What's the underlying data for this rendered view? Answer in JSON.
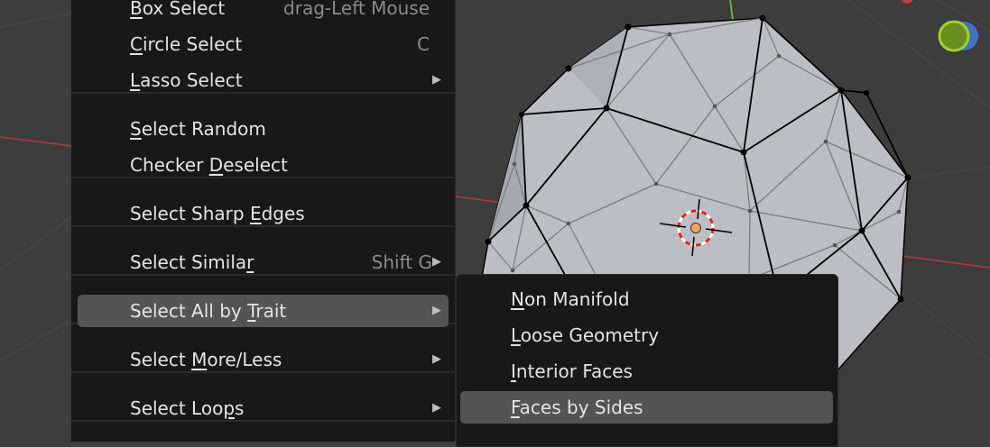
{
  "colors": {
    "menu_bg": "#181818",
    "highlight": "#545454",
    "text": "#e4e4e4",
    "shortcut": "#8a8a8a",
    "viewport_bg": "#3d3d3d"
  },
  "select_menu": {
    "items": [
      {
        "pre": "",
        "ul": "B",
        "post": "ox Select",
        "shortcut": "drag-Left Mouse",
        "submenu": false
      },
      {
        "pre": "",
        "ul": "C",
        "post": "ircle Select",
        "shortcut": "C",
        "submenu": false
      },
      {
        "pre": "",
        "ul": "L",
        "post": "asso Select",
        "shortcut": "",
        "submenu": true
      },
      {
        "pre": "",
        "ul": "S",
        "post": "elect Random",
        "shortcut": "",
        "submenu": false
      },
      {
        "pre": "Checker ",
        "ul": "D",
        "post": "eselect",
        "shortcut": "",
        "submenu": false
      },
      {
        "pre": "Select Sharp ",
        "ul": "E",
        "post": "dges",
        "shortcut": "",
        "submenu": false
      },
      {
        "pre": "Select Simila",
        "ul": "r",
        "post": "",
        "shortcut": "Shift G",
        "submenu": true
      },
      {
        "pre": "Select All by ",
        "ul": "T",
        "post": "rait",
        "shortcut": "",
        "submenu": true,
        "highlighted": true
      },
      {
        "pre": "Select ",
        "ul": "M",
        "post": "ore/Less",
        "shortcut": "",
        "submenu": true
      },
      {
        "pre": "Select Loo",
        "ul": "p",
        "post": "s",
        "shortcut": "",
        "submenu": true
      }
    ]
  },
  "trait_submenu": {
    "items": [
      {
        "pre": "",
        "ul": "N",
        "post": "on Manifold"
      },
      {
        "pre": "",
        "ul": "L",
        "post": "oose Geometry"
      },
      {
        "pre": "",
        "ul": "I",
        "post": "nterior Faces"
      },
      {
        "pre": "",
        "ul": "F",
        "post": "aces by Sides",
        "highlighted": true
      }
    ]
  },
  "viewport": {
    "object": "ico-sphere-mesh",
    "icons": [
      "3d-cursor-icon",
      "gizmo-circle-icon"
    ]
  }
}
